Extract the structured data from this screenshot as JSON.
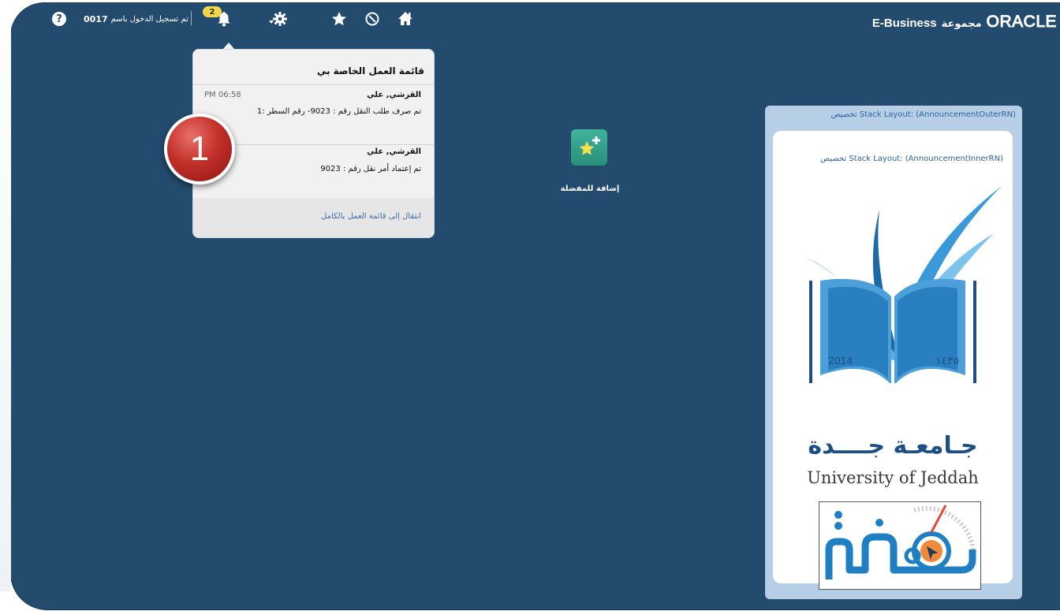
{
  "brand": {
    "logo_text": "ORACLE",
    "group_label": "مجموعة",
    "suite": "E-Business"
  },
  "header": {
    "logged_in_label": "تم تسجيل الدخول باسم",
    "username": "0017",
    "notification_count": "2",
    "icons": [
      "home-icon",
      "navigator-icon",
      "favorites-icon",
      "settings-icon",
      "bell-icon",
      "help-icon"
    ]
  },
  "worklist": {
    "title": "قائمة العمل الخاصة بي",
    "items": [
      {
        "sender": "القرشي, علي",
        "subject": "تم صرف طلب النقل رقم : 9023- رقم السطر :1",
        "time": "PM 06:58"
      },
      {
        "sender": "القرشي, علي",
        "subject": "تم إعتماد أمر نقل رقم : 9023",
        "time": ""
      }
    ],
    "full_link": "انتقال إلى قائمة العمل بالكامل"
  },
  "marker": {
    "number": "1",
    "color": "#c3302a"
  },
  "favorites": {
    "label": "إضافة للمفضلة"
  },
  "announcement": {
    "outer_label": "Stack Layout: (AnnouncementOuterRN) تخصيص",
    "inner_label": "Stack Layout: (AnnouncementInnerRN) تخصيص",
    "university_ar": "جـامعـة جــــدة",
    "university_en": "University of Jeddah",
    "year_gregorian": "2014",
    "year_hijri": "١٤٣٥",
    "kafaa_text": "كفاءة"
  },
  "colors": {
    "background": "#234b6e",
    "panel_outer": "#b7cfe6",
    "badge": "#f3d64a",
    "favorite_tile": "#2a8f7b"
  }
}
